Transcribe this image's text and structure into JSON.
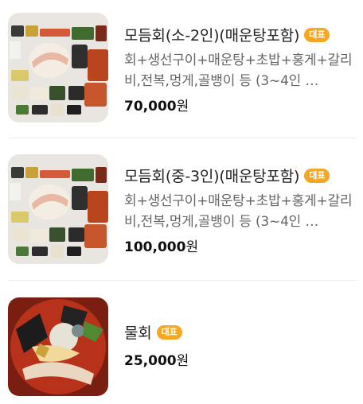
{
  "menu_items": [
    {
      "title": "모듬회(소-2인)(매운탕포함)",
      "badge": "대표",
      "description": "회+생선구이+매운탕+초밥+홍게+갈리비,전복,멍게,골뱅이 등 (3~4인 …",
      "price": "70,000",
      "currency": "원",
      "image_icon": "seafood-platter-photo"
    },
    {
      "title": "모듬회(중-3인)(매운탕포함)",
      "badge": "대표",
      "description": "회+생선구이+매운탕+초밥+홍게+갈리비,전복,멍게,골뱅이 등 (3~4인 …",
      "price": "100,000",
      "currency": "원",
      "image_icon": "seafood-platter-photo"
    },
    {
      "title": "물회",
      "badge": "대표",
      "price": "25,000",
      "currency": "원",
      "image_icon": "mulhoe-bowl-photo"
    }
  ],
  "colors": {
    "badge": "#f5a623",
    "divider": "#eeeeee"
  }
}
